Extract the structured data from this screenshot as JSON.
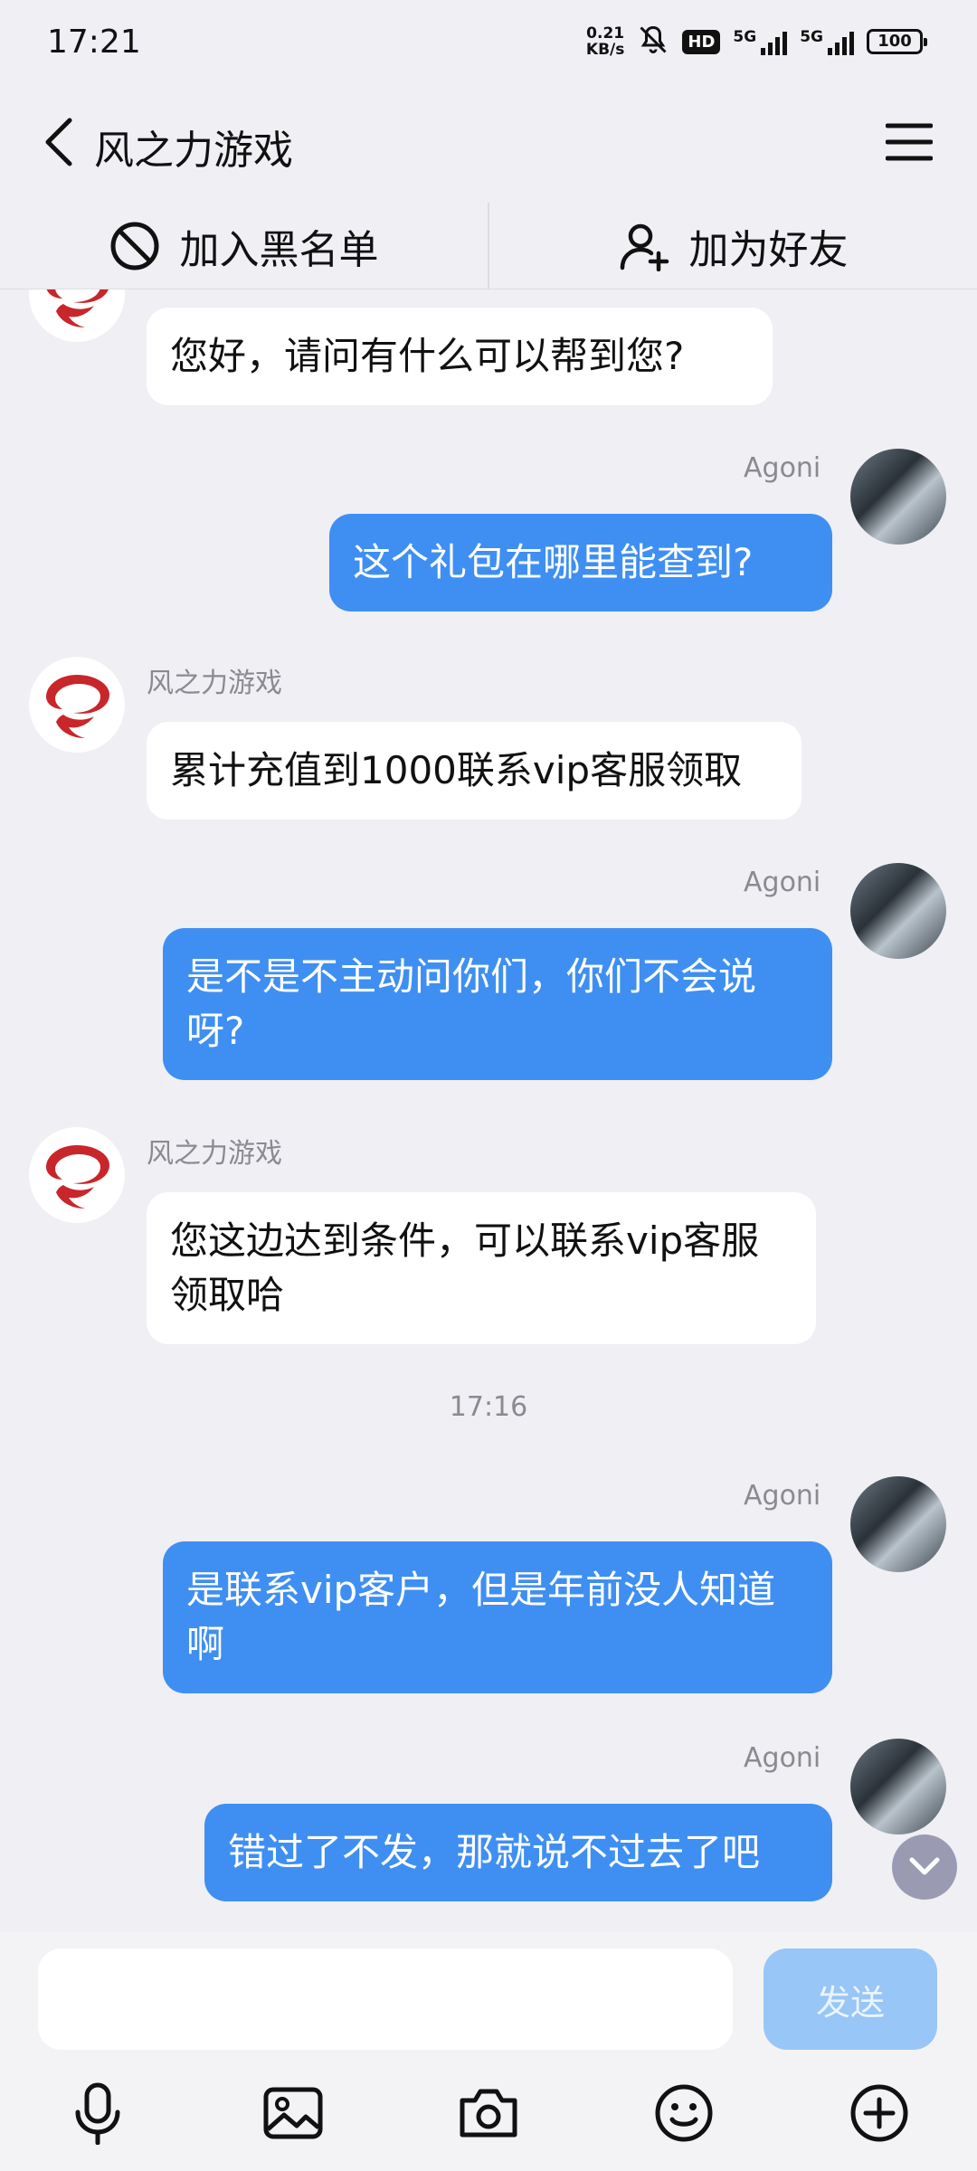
{
  "status_bar": {
    "time": "17:21",
    "net_speed_value": "0.21",
    "net_speed_unit": "KB/s",
    "hd_label": "HD",
    "sim1_label": "5G",
    "sim2_label": "5G",
    "battery": "100"
  },
  "header": {
    "title": "风之力游戏"
  },
  "actions": {
    "blacklist": "加入黑名单",
    "add_friend": "加为好友"
  },
  "messages": [
    {
      "side": "in",
      "sender": "",
      "text": "您好，请问有什么可以帮到您?"
    },
    {
      "side": "out",
      "sender": "Agoni",
      "text": "这个礼包在哪里能查到?"
    },
    {
      "side": "in",
      "sender": "风之力游戏",
      "text": "累计充值到1000联系vip客服领取"
    },
    {
      "side": "out",
      "sender": "Agoni",
      "text": "是不是不主动问你们，你们不会说呀?"
    },
    {
      "side": "in",
      "sender": "风之力游戏",
      "text": "您这边达到条件，可以联系vip客服领取哈"
    },
    {
      "side": "out",
      "sender": "Agoni",
      "text": "是联系vip客户，但是年前没人知道啊"
    },
    {
      "side": "out",
      "sender": "Agoni",
      "text": "错过了不发，那就说不过去了吧"
    }
  ],
  "timestamp": "17:16",
  "input": {
    "value": "",
    "placeholder": "",
    "send_label": "发送"
  },
  "toolbar_icons": [
    "microphone-icon",
    "image-icon",
    "camera-icon",
    "emoji-icon",
    "plus-circle-icon"
  ],
  "colors": {
    "background": "#efeff4",
    "outgoing_bubble": "#3f8ff2",
    "incoming_bubble": "#ffffff",
    "send_button": "#98c6f6"
  }
}
